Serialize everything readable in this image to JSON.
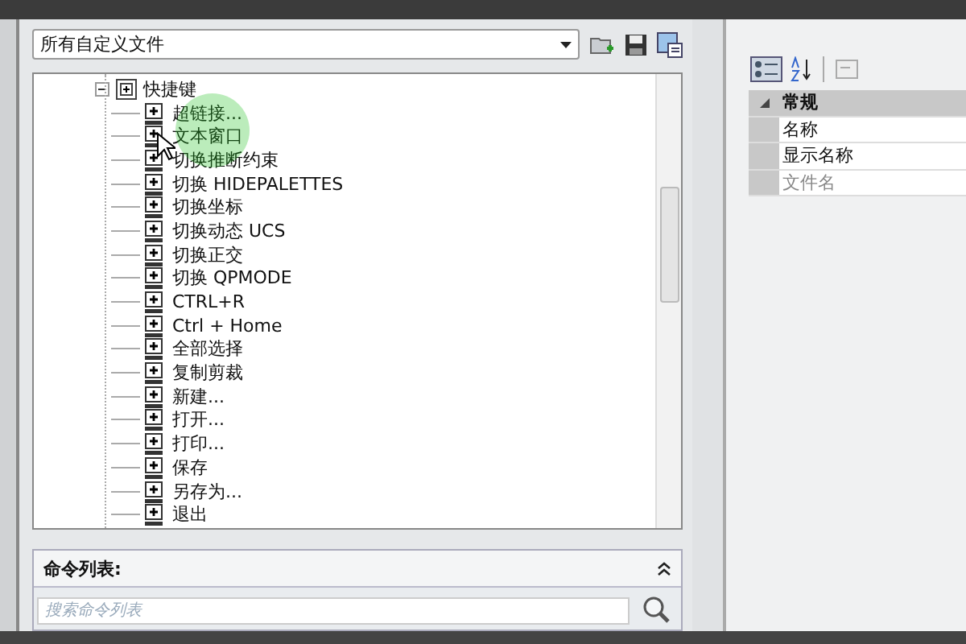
{
  "file_filter": {
    "value": "所有自定义文件"
  },
  "tree": {
    "label": "快捷键",
    "expanded": true,
    "children": [
      {
        "label": "超链接..."
      },
      {
        "label": "文本窗口"
      },
      {
        "label": "切换推断约束"
      },
      {
        "label": "切换 HIDEPALETTES"
      },
      {
        "label": "切换坐标"
      },
      {
        "label": "切换动态 UCS"
      },
      {
        "label": "切换正交"
      },
      {
        "label": "切换 QPMODE"
      },
      {
        "label": "CTRL+R"
      },
      {
        "label": "Ctrl + Home"
      },
      {
        "label": "全部选择"
      },
      {
        "label": "复制剪裁"
      },
      {
        "label": "新建..."
      },
      {
        "label": "打开..."
      },
      {
        "label": "打印..."
      },
      {
        "label": "保存"
      },
      {
        "label": "另存为..."
      },
      {
        "label": "退出"
      }
    ]
  },
  "command_list": {
    "title": "命令列表:",
    "placeholder": "搜索命令列表"
  },
  "properties": {
    "category": "常规",
    "expanded": true,
    "rows": [
      {
        "label": "名称",
        "disabled": false
      },
      {
        "label": "显示名称",
        "disabled": false
      },
      {
        "label": "文件名",
        "disabled": true
      }
    ]
  }
}
